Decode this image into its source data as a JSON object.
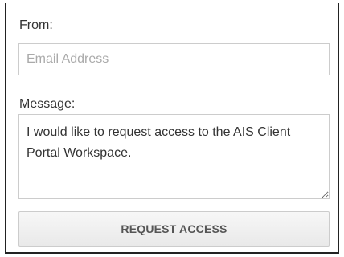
{
  "form": {
    "from_label": "From:",
    "email": {
      "placeholder": "Email Address",
      "value": ""
    },
    "message_label": "Message:",
    "message": {
      "value": "I would like to request access to the AIS Client Portal Workspace."
    },
    "submit_label": "REQUEST ACCESS"
  }
}
